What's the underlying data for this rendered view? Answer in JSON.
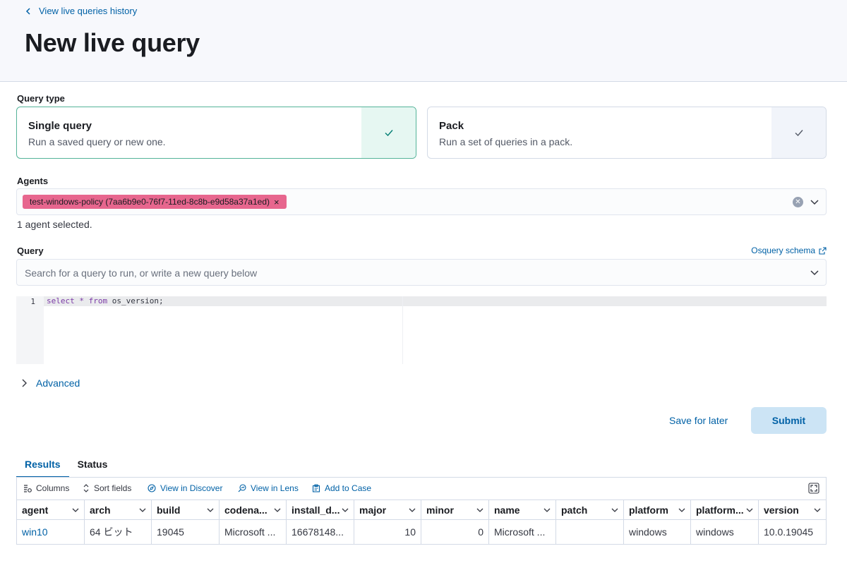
{
  "header": {
    "back_label": "View live queries history",
    "title": "New live query"
  },
  "query_type": {
    "label": "Query type",
    "options": [
      {
        "title": "Single query",
        "description": "Run a saved query or new one.",
        "selected": true
      },
      {
        "title": "Pack",
        "description": "Run a set of queries in a pack.",
        "selected": false
      }
    ]
  },
  "agents": {
    "label": "Agents",
    "selected_pill": "test-windows-policy (7aa6b9e0-76f7-11ed-8c8b-e9d58a37a1ed)",
    "pill_color": "#e7668e",
    "helper": "1 agent selected."
  },
  "query": {
    "label": "Query",
    "schema_link": "Osquery schema",
    "placeholder": "Search for a query to run, or write a new query below",
    "editor": {
      "line_number": "1",
      "tokens": [
        {
          "text": "select",
          "type": "kw"
        },
        {
          "text": " ",
          "type": "plain"
        },
        {
          "text": "*",
          "type": "op"
        },
        {
          "text": " ",
          "type": "plain"
        },
        {
          "text": "from",
          "type": "kw"
        },
        {
          "text": " os_version;",
          "type": "plain"
        }
      ]
    }
  },
  "advanced_label": "Advanced",
  "actions": {
    "save_later": "Save for later",
    "submit": "Submit"
  },
  "results": {
    "tabs": [
      "Results",
      "Status"
    ],
    "active_tab": "Results",
    "toolbar": {
      "columns": "Columns",
      "sort_fields": "Sort fields",
      "view_discover": "View in Discover",
      "view_lens": "View in Lens",
      "add_case": "Add to Case"
    },
    "columns": [
      "agent",
      "arch",
      "build",
      "codena...",
      "install_d...",
      "major",
      "minor",
      "name",
      "patch",
      "platform",
      "platform...",
      "version"
    ],
    "rows": [
      [
        "win10",
        "64 ビット",
        "19045",
        "Microsoft ...",
        "16678148...",
        "10",
        "0",
        "Microsoft ...",
        "",
        "windows",
        "windows",
        "10.0.19045"
      ]
    ]
  },
  "colors": {
    "accent": "#0061a6",
    "selected_border": "#54b399",
    "submit_bg": "#cce4f5"
  }
}
